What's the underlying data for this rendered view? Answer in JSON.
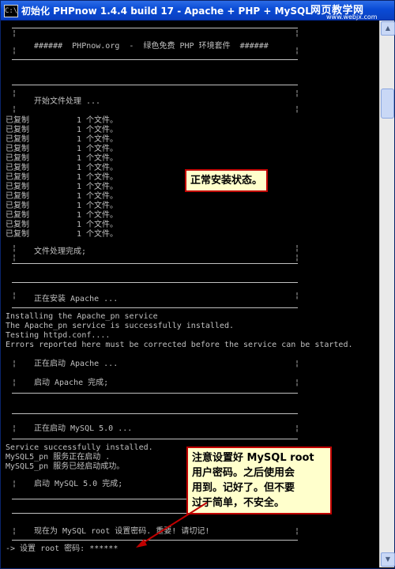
{
  "window": {
    "title": "初始化 PHPnow 1.4.4 build 17 - Apache + PHP + MySQL",
    "icon_text": "C:\\",
    "watermark_cn": "网页教学网",
    "watermark_url": "www.webjx.com"
  },
  "console": {
    "banner": "######  PHPnow.org  -  绿色免费 PHP 环境套件  ######",
    "start_files": "开始文件处理 ...",
    "copied_label": "已复制",
    "copied_count": "1 个文件。",
    "copied_times": 13,
    "files_done": "文件处理完成;",
    "installing_apache": "正在安装 Apache ...",
    "apache_out": [
      "Installing the Apache_pn service",
      "The Apache_pn service is successfully installed.",
      "Testing httpd.conf....",
      "Errors reported here must be corrected before the service can be started."
    ],
    "starting_apache": "正在启动 Apache ...",
    "apache_done": "启动 Apache 完成;",
    "starting_mysql": "正在启动 MySQL 5.0 ...",
    "mysql_out": [
      "Service successfully installed.",
      "MySQL5_pn 服务正在启动 .",
      "MySQL5_pn 服务已经启动成功。"
    ],
    "mysql_done": "启动 MySQL 5.0 完成;",
    "set_pwd_notice": "现在为 MySQL root 设置密码. 重要! 请切记!",
    "prompt": "-> 设置 root 密码: ******"
  },
  "annotations": {
    "normal_state": "正常安装状态。",
    "mysql_note": [
      "注意设置好 MySQL root",
      "用户密码。之后使用会",
      "用到。记好了。但不要",
      "过于简单，不安全。"
    ]
  },
  "colors": {
    "titlebar": "#0a4bd6",
    "console_text": "#c0c0c0",
    "callout_border": "#c00000",
    "callout_bg": "#ffffcc"
  }
}
